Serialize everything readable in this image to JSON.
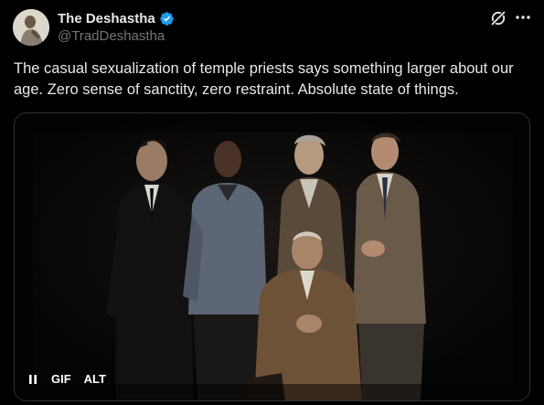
{
  "author": {
    "display_name": "The Deshastha",
    "handle": "@TradDeshastha",
    "verified": true,
    "verified_badge_color": "#1d9bf0"
  },
  "post": {
    "text": "The casual sexualization of temple priests says something larger about our age. Zero sense of sanctity, zero restraint. Absolute state of things."
  },
  "media": {
    "type": "gif",
    "gif_label": "GIF",
    "alt_label": "ALT"
  },
  "icons": {
    "grok": "grok-icon",
    "more": "more-icon",
    "pause": "pause-icon",
    "verified": "verified-badge-icon"
  },
  "colors": {
    "background": "#000000",
    "text_primary": "#e7e9ea",
    "text_secondary": "#71767b",
    "border": "#2f3336"
  }
}
